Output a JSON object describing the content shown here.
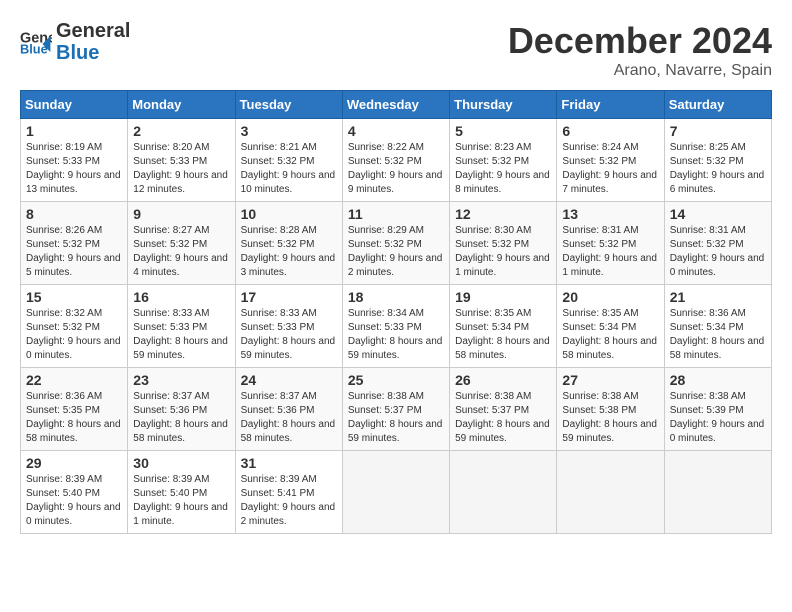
{
  "header": {
    "logo_general": "General",
    "logo_blue": "Blue",
    "month": "December 2024",
    "location": "Arano, Navarre, Spain"
  },
  "calendar": {
    "days_of_week": [
      "Sunday",
      "Monday",
      "Tuesday",
      "Wednesday",
      "Thursday",
      "Friday",
      "Saturday"
    ],
    "weeks": [
      [
        {
          "day": "1",
          "sunrise": "8:19 AM",
          "sunset": "5:33 PM",
          "daylight": "9 hours and 13 minutes."
        },
        {
          "day": "2",
          "sunrise": "8:20 AM",
          "sunset": "5:33 PM",
          "daylight": "9 hours and 12 minutes."
        },
        {
          "day": "3",
          "sunrise": "8:21 AM",
          "sunset": "5:32 PM",
          "daylight": "9 hours and 10 minutes."
        },
        {
          "day": "4",
          "sunrise": "8:22 AM",
          "sunset": "5:32 PM",
          "daylight": "9 hours and 9 minutes."
        },
        {
          "day": "5",
          "sunrise": "8:23 AM",
          "sunset": "5:32 PM",
          "daylight": "9 hours and 8 minutes."
        },
        {
          "day": "6",
          "sunrise": "8:24 AM",
          "sunset": "5:32 PM",
          "daylight": "9 hours and 7 minutes."
        },
        {
          "day": "7",
          "sunrise": "8:25 AM",
          "sunset": "5:32 PM",
          "daylight": "9 hours and 6 minutes."
        }
      ],
      [
        {
          "day": "8",
          "sunrise": "8:26 AM",
          "sunset": "5:32 PM",
          "daylight": "9 hours and 5 minutes."
        },
        {
          "day": "9",
          "sunrise": "8:27 AM",
          "sunset": "5:32 PM",
          "daylight": "9 hours and 4 minutes."
        },
        {
          "day": "10",
          "sunrise": "8:28 AM",
          "sunset": "5:32 PM",
          "daylight": "9 hours and 3 minutes."
        },
        {
          "day": "11",
          "sunrise": "8:29 AM",
          "sunset": "5:32 PM",
          "daylight": "9 hours and 2 minutes."
        },
        {
          "day": "12",
          "sunrise": "8:30 AM",
          "sunset": "5:32 PM",
          "daylight": "9 hours and 1 minute."
        },
        {
          "day": "13",
          "sunrise": "8:31 AM",
          "sunset": "5:32 PM",
          "daylight": "9 hours and 1 minute."
        },
        {
          "day": "14",
          "sunrise": "8:31 AM",
          "sunset": "5:32 PM",
          "daylight": "9 hours and 0 minutes."
        }
      ],
      [
        {
          "day": "15",
          "sunrise": "8:32 AM",
          "sunset": "5:32 PM",
          "daylight": "9 hours and 0 minutes."
        },
        {
          "day": "16",
          "sunrise": "8:33 AM",
          "sunset": "5:33 PM",
          "daylight": "8 hours and 59 minutes."
        },
        {
          "day": "17",
          "sunrise": "8:33 AM",
          "sunset": "5:33 PM",
          "daylight": "8 hours and 59 minutes."
        },
        {
          "day": "18",
          "sunrise": "8:34 AM",
          "sunset": "5:33 PM",
          "daylight": "8 hours and 59 minutes."
        },
        {
          "day": "19",
          "sunrise": "8:35 AM",
          "sunset": "5:34 PM",
          "daylight": "8 hours and 58 minutes."
        },
        {
          "day": "20",
          "sunrise": "8:35 AM",
          "sunset": "5:34 PM",
          "daylight": "8 hours and 58 minutes."
        },
        {
          "day": "21",
          "sunrise": "8:36 AM",
          "sunset": "5:34 PM",
          "daylight": "8 hours and 58 minutes."
        }
      ],
      [
        {
          "day": "22",
          "sunrise": "8:36 AM",
          "sunset": "5:35 PM",
          "daylight": "8 hours and 58 minutes."
        },
        {
          "day": "23",
          "sunrise": "8:37 AM",
          "sunset": "5:36 PM",
          "daylight": "8 hours and 58 minutes."
        },
        {
          "day": "24",
          "sunrise": "8:37 AM",
          "sunset": "5:36 PM",
          "daylight": "8 hours and 58 minutes."
        },
        {
          "day": "25",
          "sunrise": "8:38 AM",
          "sunset": "5:37 PM",
          "daylight": "8 hours and 59 minutes."
        },
        {
          "day": "26",
          "sunrise": "8:38 AM",
          "sunset": "5:37 PM",
          "daylight": "8 hours and 59 minutes."
        },
        {
          "day": "27",
          "sunrise": "8:38 AM",
          "sunset": "5:38 PM",
          "daylight": "8 hours and 59 minutes."
        },
        {
          "day": "28",
          "sunrise": "8:38 AM",
          "sunset": "5:39 PM",
          "daylight": "9 hours and 0 minutes."
        }
      ],
      [
        {
          "day": "29",
          "sunrise": "8:39 AM",
          "sunset": "5:40 PM",
          "daylight": "9 hours and 0 minutes."
        },
        {
          "day": "30",
          "sunrise": "8:39 AM",
          "sunset": "5:40 PM",
          "daylight": "9 hours and 1 minute."
        },
        {
          "day": "31",
          "sunrise": "8:39 AM",
          "sunset": "5:41 PM",
          "daylight": "9 hours and 2 minutes."
        },
        null,
        null,
        null,
        null
      ]
    ]
  }
}
